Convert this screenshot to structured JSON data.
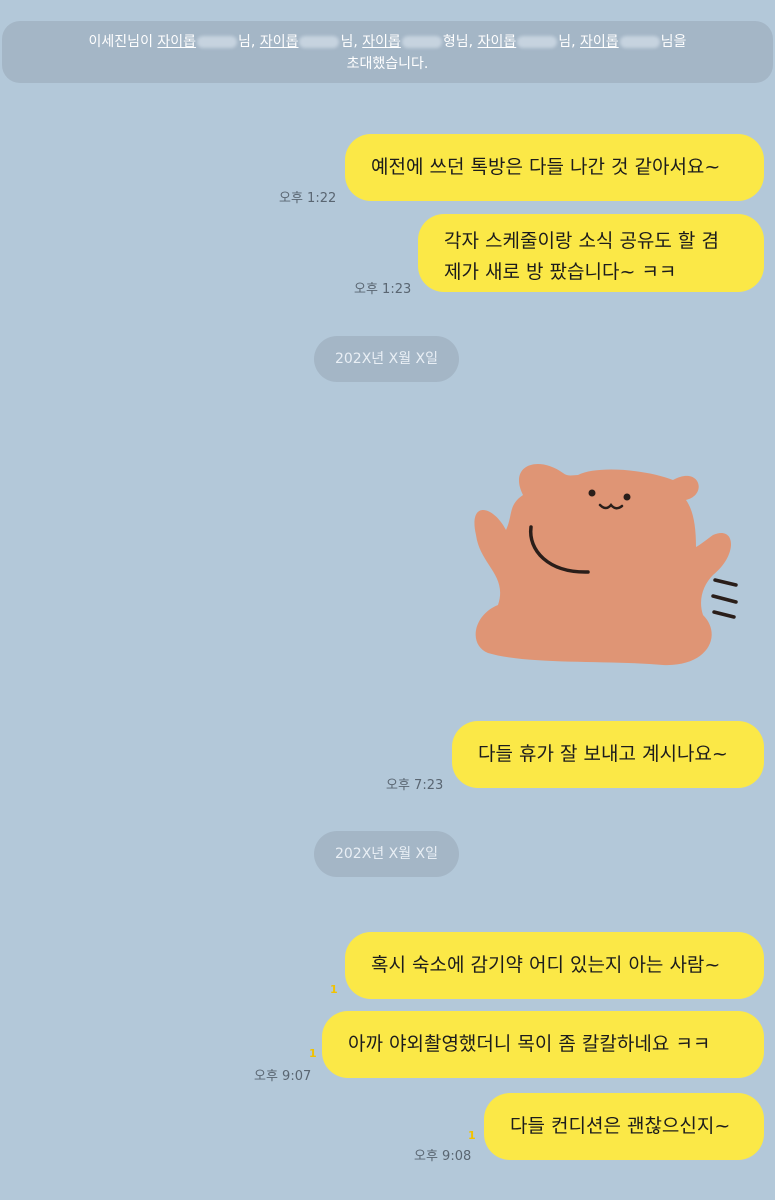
{
  "system_message": {
    "inviter": "이세진님이",
    "invitees": [
      {
        "name": "자이롭",
        "suffix": "님,"
      },
      {
        "name": "자이롭",
        "suffix": "님,"
      },
      {
        "name": "자이롭",
        "suffix": "형님,"
      },
      {
        "name": "자이롭",
        "suffix": "님,"
      },
      {
        "name": "자이롭",
        "suffix": "님을"
      }
    ],
    "line2": "초대했습니다."
  },
  "messages": [
    {
      "text": "예전에 쓰던 톡방은 다들 나간 것 같아서요~"
    },
    {
      "line1": "각자 스케줄이랑 소식 공유도 할 겸",
      "line2": "제가 새로 방 팠습니다~ ㅋㅋ"
    },
    {
      "text": "다들 휴가 잘 보내고 계시나요~"
    },
    {
      "text": "혹시 숙소에 감기약 어디 있는지 아는 사람~",
      "unread": "1"
    },
    {
      "text": "아까 야외촬영했더니 목이 좀 칼칼하네요 ㅋㅋ",
      "unread": "1"
    },
    {
      "text": "다들 컨디션은 괜찮으신지~",
      "unread": "1"
    }
  ],
  "times": {
    "t1": "오후 1:22",
    "t2": "오후 1:23",
    "t3": "오후 7:23",
    "t4": "오후 9:07",
    "t5": "오후 9:08"
  },
  "date_dividers": [
    "202X년 X월 X일",
    "202X년 X월 X일"
  ],
  "sticker": {
    "name": "bear-sticker",
    "color": "#df9575"
  },
  "colors": {
    "background": "#b3c8d9",
    "my_bubble": "#fbe847",
    "pill": "#a4b6c6",
    "unread": "#f2c200"
  }
}
